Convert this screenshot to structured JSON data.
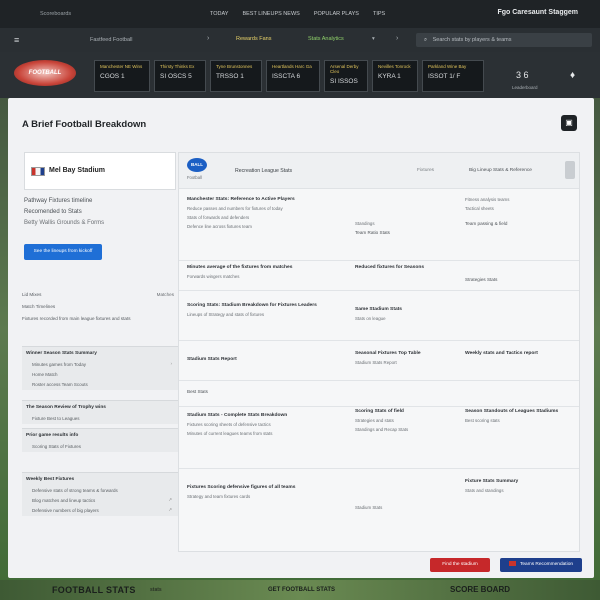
{
  "topbar": {
    "brand": "Scoreboards",
    "links": [
      "TODAY",
      "BEST LINEUPS NEWS",
      "POPULAR PLAYS",
      "TIPS"
    ],
    "right": "Fgo Caresaunt Staggem"
  },
  "navbar": {
    "site": "Fastfeed Football",
    "pill1": "Rewards Fans",
    "pill2": "Stats Analytics",
    "search_placeholder": "Search stats by players & teams"
  },
  "logo_text": "FOOTBALL",
  "score_cards": [
    {
      "team": "Manchester NE Wins",
      "score": "CGOS  1"
    },
    {
      "team": "Thirsty Thinks Ex",
      "score": "SI OSCS  5"
    },
    {
      "team": "Tyne Brunstonnes",
      "score": "TRSSO  1"
    },
    {
      "team": "Heartlands Harc Ga",
      "score": "ISSCTA  6"
    },
    {
      "team": "Arsenal Derby Cleo",
      "score": "SI ISSOS"
    },
    {
      "team": "Nevilles Tonrock",
      "score": "KYRA  1"
    },
    {
      "team": "Parkland Wine Bay",
      "score": "ISSOT  1/ F"
    }
  ],
  "mini_scores": {
    "value": "3  6",
    "sub": "Leaderboard"
  },
  "main": {
    "title": "A Brief Football Breakdown",
    "left_card_name": "Mel Bay Stadium",
    "left_info": [
      "Pathway  Fixtures timeline",
      "Recomended to Stats",
      "Betty   Wallis Grounds & Forms"
    ],
    "blue_button": "See the lineups from kickoff",
    "left_list": [
      {
        "l": "Lid Mixes",
        "r": "Matches"
      },
      {
        "l": "Match Timelines",
        "r": ""
      },
      {
        "l": "Fixtures recorded from main league fixtures and stats",
        "r": ""
      }
    ],
    "sections": [
      {
        "h": "Winner Season Stats Summary",
        "items": [
          "Minutes games from Today",
          "Home Match",
          "Roster access Team Scouts"
        ]
      },
      {
        "h": "The Season Review of Trophy wins",
        "items": [
          "Fixture Best to Leagues"
        ]
      },
      {
        "h": "Prior game results info",
        "items": [
          "Scoring Stats of Fixtures"
        ]
      },
      {
        "h": "Weekly Best Fixtures",
        "items": [
          "Defensive stats of strong teams & forwards",
          "Blog matches and lineup tactics",
          "Defensive numbers of big players"
        ]
      }
    ],
    "right_card": {
      "logo": "BALL",
      "logo_sub": "Football",
      "title": "Recreation League Stats",
      "mid": "Fixtures",
      "right": "Big Lineup Stats & Reference"
    },
    "sections_right": [
      {
        "c1": {
          "h": "Manchester Stats: Reference to Active Players",
          "p": [
            "Reduce passes and numbers for fixtures of today",
            "Stats of forwards and defenders",
            "Defence line across fixtures team"
          ]
        },
        "c2": {
          "h": "",
          "p": [
            "Standings"
          ],
          "q": [
            "Team Ratio Stats"
          ]
        },
        "c3": {
          "h": "",
          "p": [
            "Fitness analysis teams",
            "Tactical sheets"
          ],
          "q": [
            "Team passing & field"
          ]
        }
      },
      {
        "c1": {
          "h": "Minutes average of the fixtures from matches",
          "p": [
            "Forwards wingers matches"
          ]
        },
        "c2": {
          "h": "Reduced fixtures for Seasons",
          "p": []
        },
        "c3": {
          "h": "Strategies Stats",
          "p": []
        }
      },
      {
        "c1": {
          "h": "Scoring Stats: Stadium Breakdown for Fixtures Leaders",
          "p": [
            "Lineups of Strategy and stats of fixtures"
          ]
        },
        "c2": {
          "h": "Same Stadium Stats",
          "p": [
            "Stats on league"
          ]
        },
        "c3": {
          "h": "",
          "p": []
        }
      },
      {
        "c1": {
          "h": "Stadium Stats Report",
          "p": []
        },
        "c2": {
          "h": "Seasonal Fixtures Top Table",
          "p": [
            "Stadium Stats Report"
          ]
        },
        "c3": {
          "h": "Weekly stats and Tactics report",
          "p": []
        }
      },
      {
        "c1": {
          "h": "Best Stats",
          "p": []
        },
        "c2": {
          "h": "",
          "p": []
        },
        "c3": {
          "h": "",
          "p": []
        }
      },
      {
        "c1": {
          "h": "Stadium Stats - Complete Stats Breakdown",
          "p": [
            "Fixtures scoring sheets of defensive tactics",
            "Minutes of current leagues teams from stats"
          ]
        },
        "c2": {
          "h": "Scoring Stats of field",
          "p": [
            "Strategies and stats",
            "Standings and Recap Stats"
          ]
        },
        "c3": {
          "h": "Season Standouts of Leagues Stadiums",
          "p": [
            "Best scoring stats"
          ]
        }
      },
      {
        "c1": {
          "h": "Fixtures Scoring defensive figures of all teams",
          "p": [
            "Strategy and team fixtures cards"
          ]
        },
        "c2": {
          "h": "",
          "p": [
            "Stadium Stats"
          ]
        },
        "c3": {
          "h": "Fixture Stats Summary",
          "p": [
            "Stats and standings"
          ]
        }
      }
    ],
    "red_button": "Find the stadium",
    "navy_button": "Teams Recommendation"
  },
  "footer": {
    "f1": "FOOTBALL STATS",
    "f2": "stats",
    "f3": "GET FOOTBALL STATS",
    "f4": "SCORE BOARD"
  }
}
